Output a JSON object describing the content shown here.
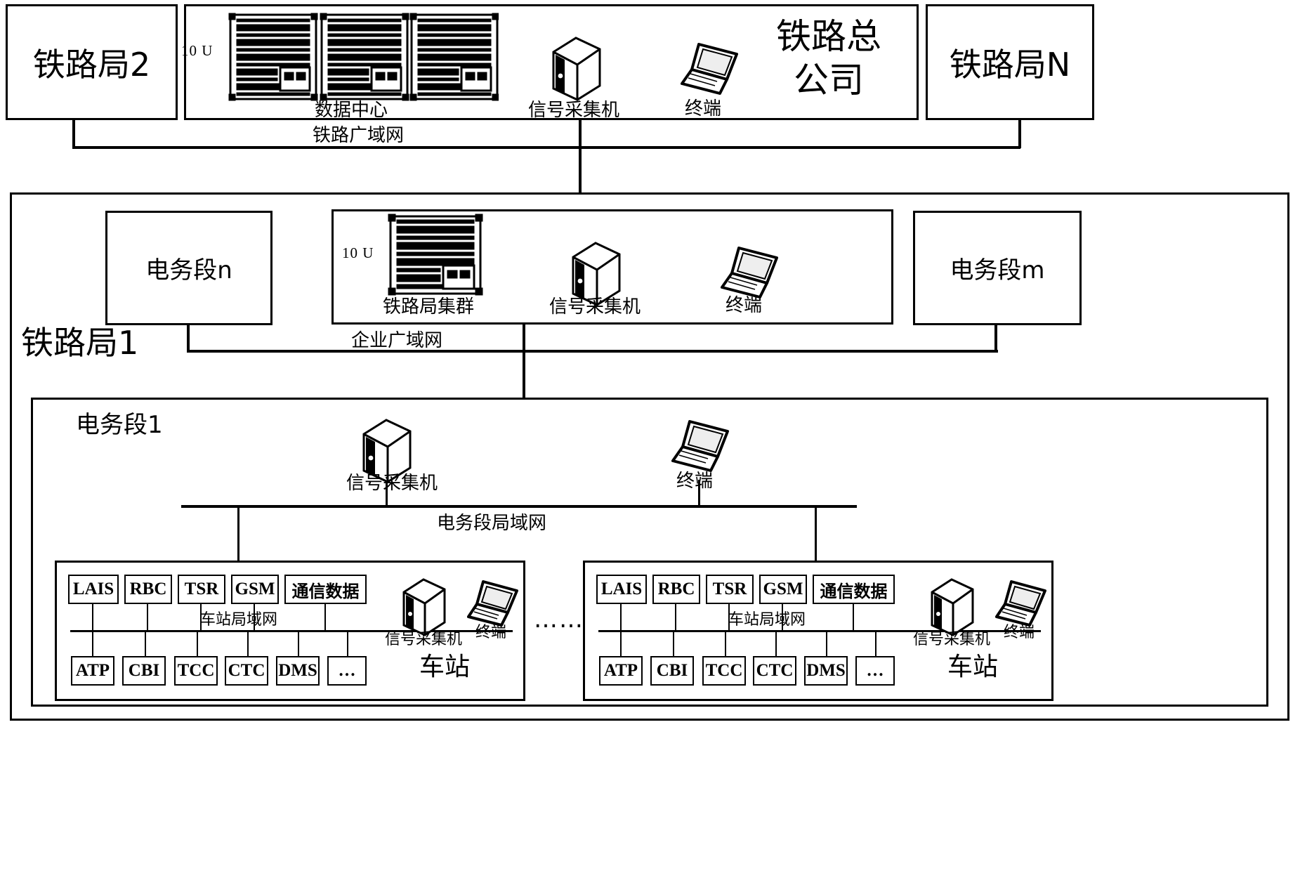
{
  "diagram": {
    "title_nodes": {
      "bureau2": "铁路局2",
      "bureauN": "铁路局N",
      "head_company": "铁路总\n公司",
      "bureau1": "铁路局1"
    },
    "top_panel": {
      "rack_height_label": "10 U",
      "data_center_label": "数据中心",
      "signal_collector_label": "信号采集机",
      "terminal_label": "终端"
    },
    "networks": {
      "railway_wan": "铁路广域网",
      "enterprise_wan": "企业广域网",
      "depot_lan": "电务段局域网",
      "station_lan": "车站局域网"
    },
    "bureau1_panel": {
      "depot_n": "电务段n",
      "depot_m": "电务段m",
      "rack_height_label": "10 U",
      "bureau_cluster_label": "铁路局集群",
      "signal_collector_label": "信号采集机",
      "terminal_label": "终端"
    },
    "depot1_panel": {
      "title": "电务段1",
      "signal_collector_label": "信号采集机",
      "terminal_label": "终端",
      "ellipsis": "……"
    },
    "stations": [
      {
        "name": "车站",
        "top_row": [
          "LAIS",
          "RBC",
          "TSR",
          "GSM",
          "通信数据"
        ],
        "bottom_row": [
          "ATP",
          "CBI",
          "TCC",
          "CTC",
          "DMS",
          "…"
        ],
        "lan_label": "车站局域网",
        "signal_collector_label": "信号采集机",
        "terminal_label": "终端"
      },
      {
        "name": "车站",
        "top_row": [
          "LAIS",
          "RBC",
          "TSR",
          "GSM",
          "通信数据"
        ],
        "bottom_row": [
          "ATP",
          "CBI",
          "TCC",
          "CTC",
          "DMS",
          "…"
        ],
        "lan_label": "车站局域网",
        "signal_collector_label": "信号采集机",
        "terminal_label": "终端"
      }
    ],
    "colors": {
      "stroke": "#000000",
      "background": "#ffffff"
    }
  }
}
